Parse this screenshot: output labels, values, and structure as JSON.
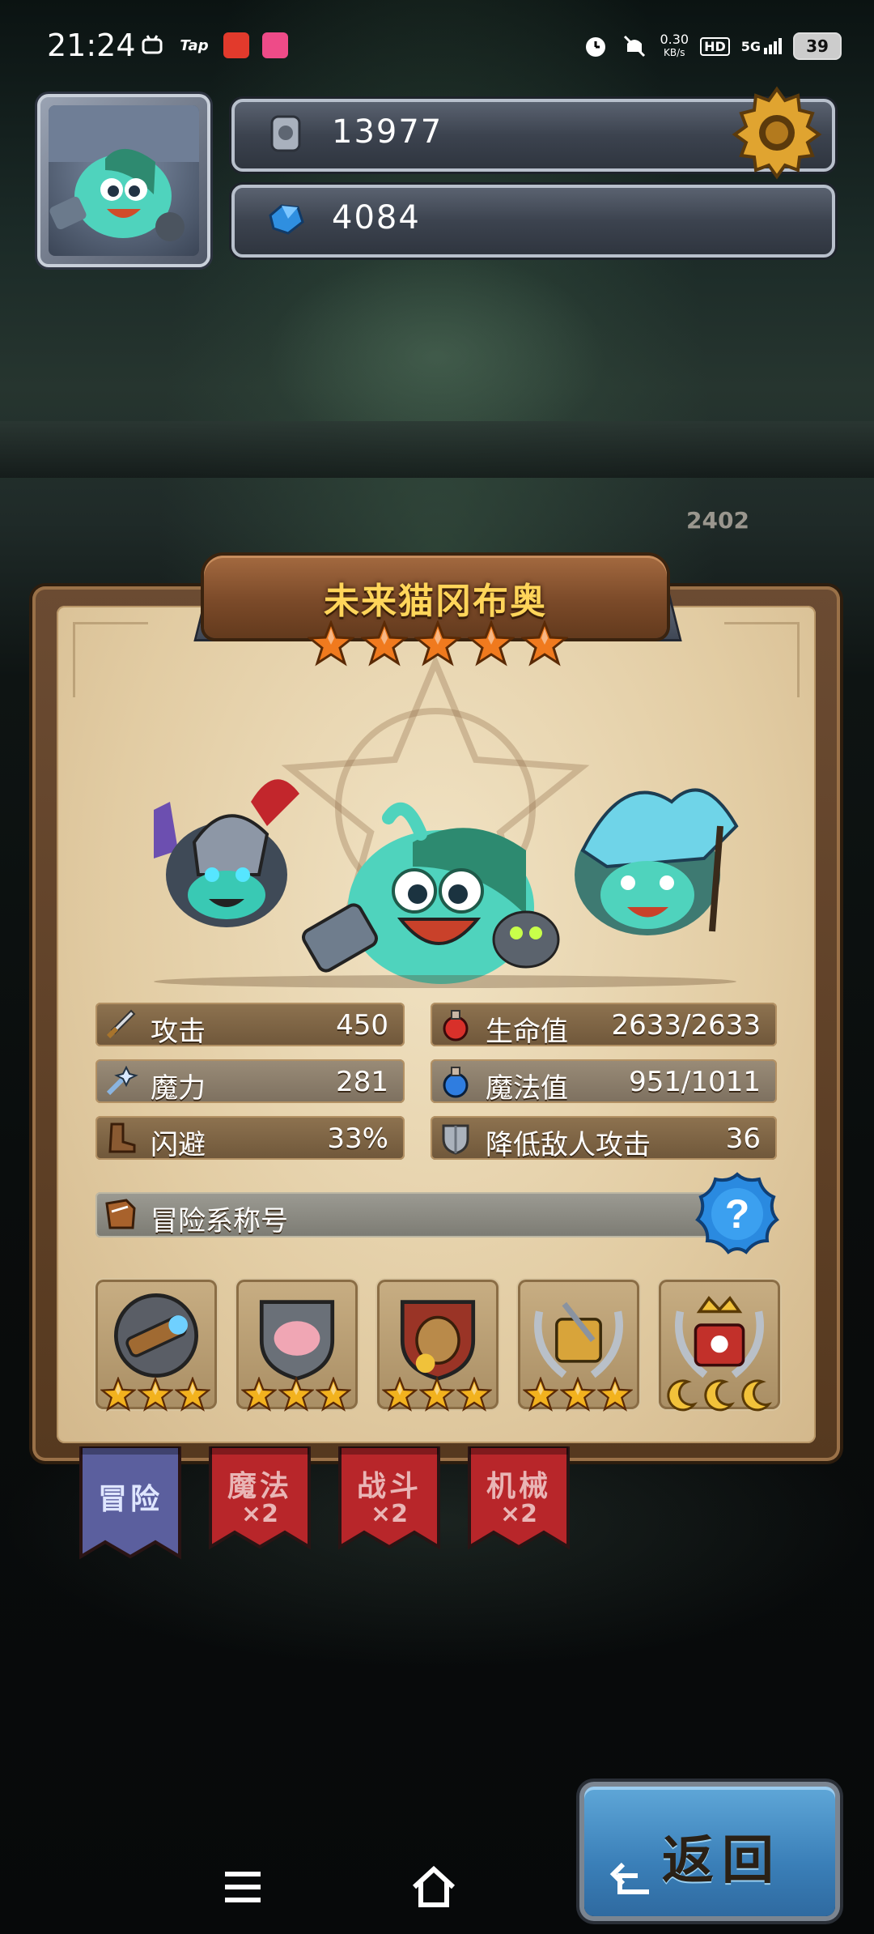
{
  "status_bar": {
    "time": "21:24",
    "app_icons": [
      "bilibili-icon",
      "taptap-icon",
      "game-icon",
      "app-icon"
    ],
    "tap_label": "Tap",
    "speed": "0.30",
    "speed_unit": "KB/s",
    "hd": "HD",
    "network": "5G",
    "battery": "39"
  },
  "hud": {
    "stone_currency": "13977",
    "gem_currency": "4084"
  },
  "enemy_power": "2402",
  "hero": {
    "name": "未来猫冈布奥",
    "stars": 5
  },
  "stats": {
    "left": [
      {
        "icon": "sword-icon",
        "label": "攻击",
        "value": "450"
      },
      {
        "icon": "magic-wand-icon",
        "label": "魔力",
        "value": "281"
      },
      {
        "icon": "boot-icon",
        "label": "闪避",
        "value": "33%"
      }
    ],
    "right": [
      {
        "icon": "red-potion-icon",
        "label": "生命值",
        "value": "2633/2633"
      },
      {
        "icon": "blue-potion-icon",
        "label": "魔法值",
        "value": "951/1011"
      },
      {
        "icon": "shield-icon",
        "label": "降低敌人攻击",
        "value": "36"
      }
    ]
  },
  "title_section": {
    "label": "冒险系称号",
    "help": "?"
  },
  "badges": [
    {
      "icon": "telescope-badge-icon",
      "stars": 3,
      "type": "star"
    },
    {
      "icon": "pig-shield-badge-icon",
      "stars": 3,
      "type": "star"
    },
    {
      "icon": "money-bag-badge-icon",
      "stars": 3,
      "type": "star"
    },
    {
      "icon": "treasure-laurel-badge-icon",
      "stars": 3,
      "type": "star"
    },
    {
      "icon": "crown-chest-badge-icon",
      "stars": 3,
      "type": "moon"
    }
  ],
  "categories": [
    {
      "label": "冒险",
      "mult": "",
      "active": true
    },
    {
      "label": "魔法",
      "mult": "×2",
      "active": false
    },
    {
      "label": "战斗",
      "mult": "×2",
      "active": false
    },
    {
      "label": "机械",
      "mult": "×2",
      "active": false
    }
  ],
  "back_button": {
    "label": "返回"
  },
  "colors": {
    "gold_title": "#ffd55a",
    "banner_red": "#b8262a",
    "banner_purple": "#5b5f9e",
    "back_blue": "#3a7fb8"
  }
}
